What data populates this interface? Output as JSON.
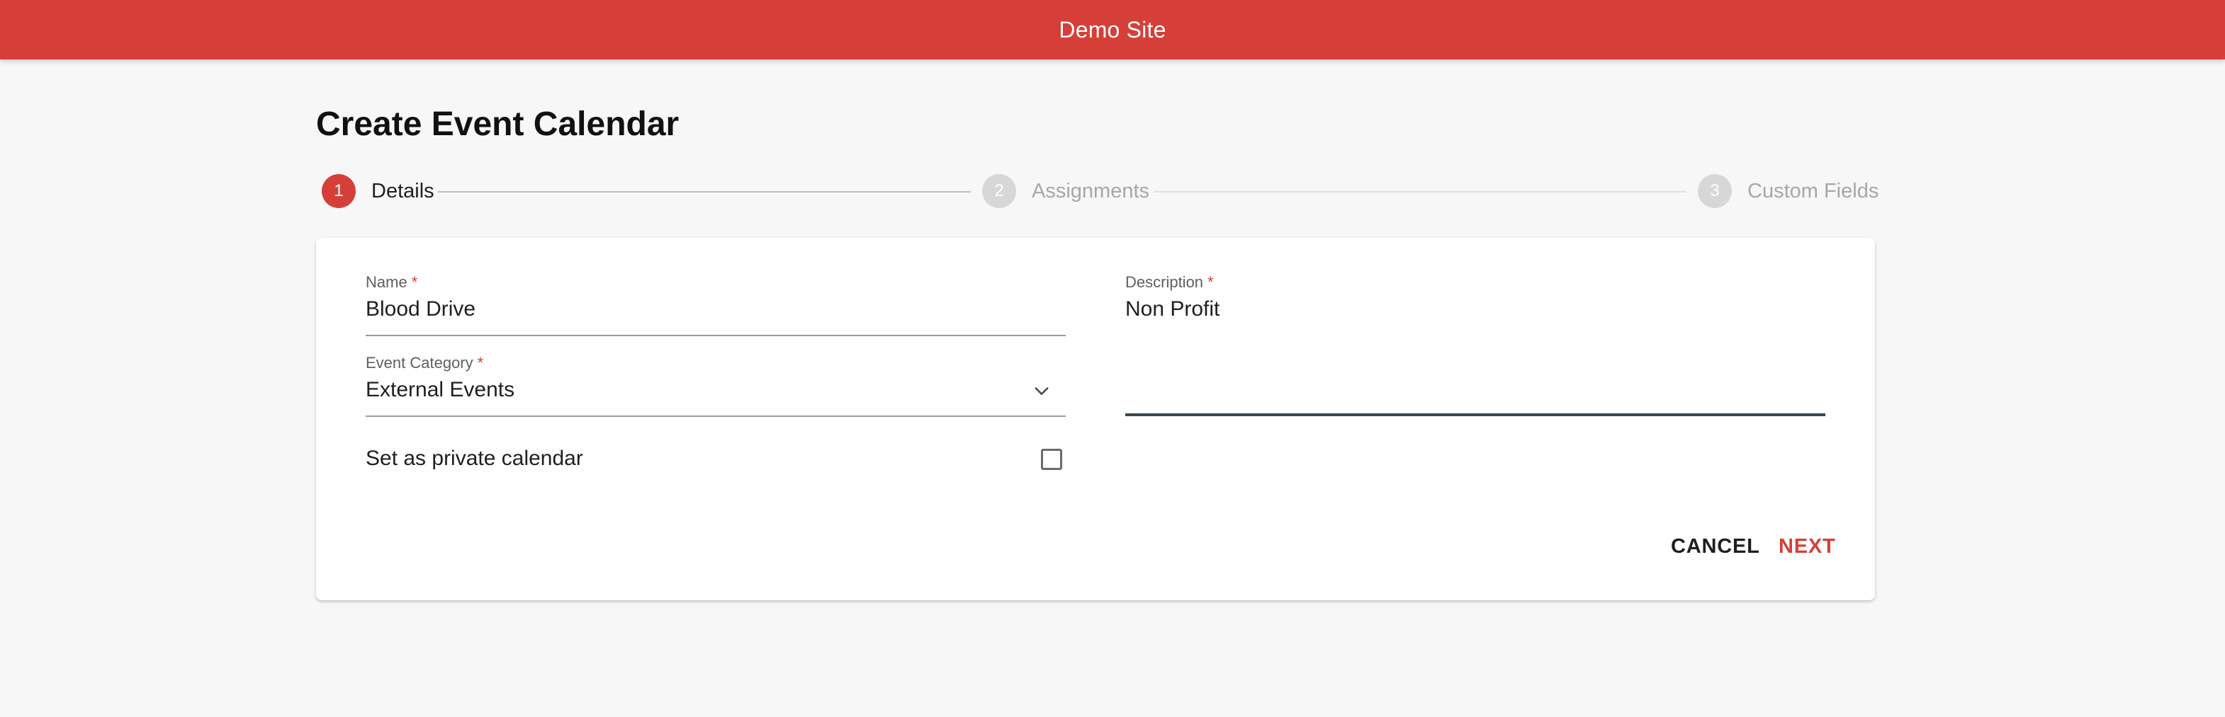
{
  "app": {
    "site_title": "Demo Site"
  },
  "page": {
    "title": "Create Event Calendar"
  },
  "stepper": {
    "steps": [
      {
        "number": "1",
        "label": "Details",
        "state": "active"
      },
      {
        "number": "2",
        "label": "Assignments",
        "state": "inactive"
      },
      {
        "number": "3",
        "label": "Custom Fields",
        "state": "inactive"
      }
    ]
  },
  "form": {
    "name": {
      "label": "Name",
      "required_mark": "*",
      "value": "Blood Drive"
    },
    "description": {
      "label": "Description",
      "required_mark": "*",
      "value": "Non Profit"
    },
    "event_category": {
      "label": "Event Category",
      "required_mark": "*",
      "value": "External Events"
    },
    "private_calendar": {
      "label": "Set as private calendar",
      "checked": false
    }
  },
  "actions": {
    "cancel_label": "CANCEL",
    "next_label": "NEXT"
  },
  "icons": {
    "dropdown": "chevron-down-icon",
    "checkbox": "checkbox-unchecked-icon"
  },
  "colors": {
    "brand": "#d63f38",
    "background": "#f7f7f7",
    "inactive_step": "#d7d7d7"
  }
}
